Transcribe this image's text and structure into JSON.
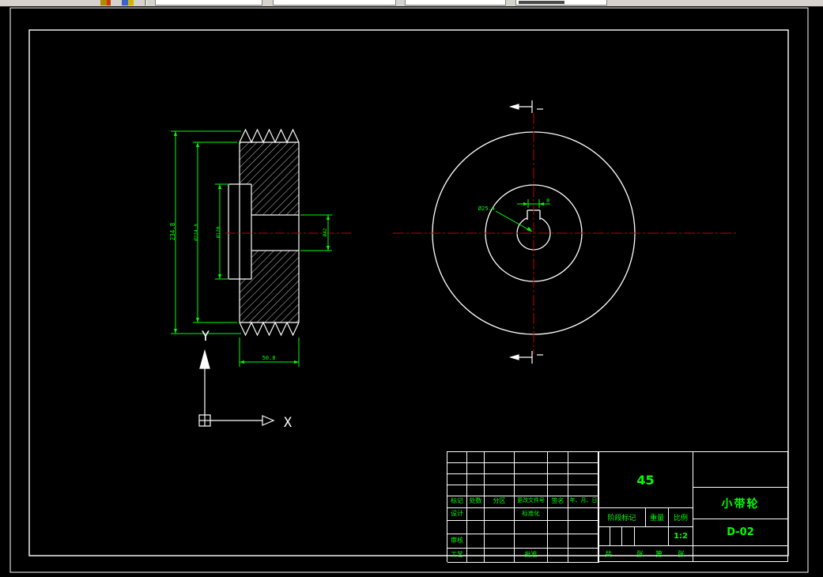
{
  "window": {
    "app_hint": "CAD drawing viewport (toolbar cropped at top)"
  },
  "colors": {
    "entity_green": "#00ff00",
    "centerline_red": "#c00000",
    "geometry_white": "#ffffff",
    "canvas_black": "#000000",
    "toolbar_gray": "#d6d3ce"
  },
  "drawing": {
    "dimensions": {
      "outer_diameter": "234.8",
      "groove_root_diameter": "Ø224.8",
      "hub_diameter": "Ø120",
      "bore_span": "Ø42",
      "face_width": "50.8",
      "keyway_width": "8",
      "bore_diameter": "Ø25.4"
    },
    "ucs": {
      "x_label": "X",
      "y_label": "Y"
    }
  },
  "title_block": {
    "header": [
      "标记",
      "处数",
      "分区",
      "更改文件号",
      "签名",
      "年、月、日"
    ],
    "design_label": "设计",
    "standardization_label": "标准化",
    "review_label": "审核",
    "process_label": "工艺",
    "approve_label": "批准",
    "material": "45",
    "stage_label": "阶段标记",
    "weight_label": "重量",
    "scale_label": "比例",
    "scale_value": "1:2",
    "sheets": {
      "total_label": "共",
      "sheet_label": "张",
      "page_label": "第",
      "page2_label": "张"
    },
    "part_name": "小带轮",
    "drawing_number": "D-02"
  }
}
